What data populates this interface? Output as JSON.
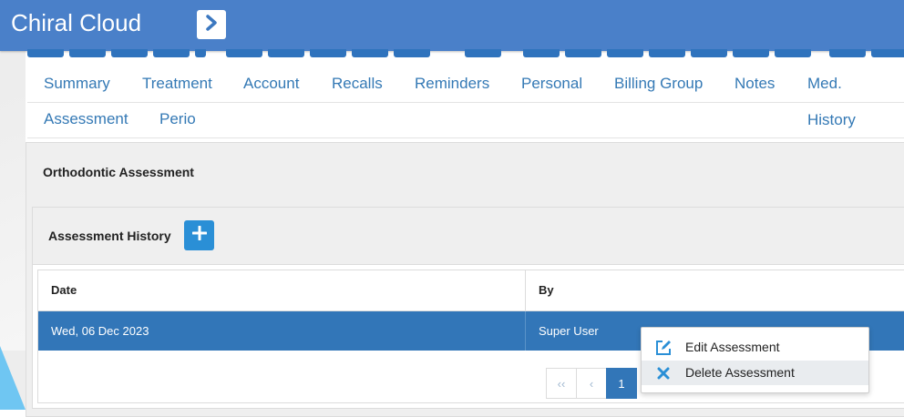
{
  "app": {
    "title": "Chiral Cloud",
    "brand_color": "#4a80c9"
  },
  "header": {
    "toggle_icon": "chevron-right-icon"
  },
  "tabs_row1": [
    "Summary",
    "Treatment",
    "Account",
    "Recalls",
    "Reminders",
    "Personal",
    "Billing Group",
    "Notes",
    "Med. History"
  ],
  "tabs_row2": [
    "Assessment",
    "Perio"
  ],
  "panel": {
    "title": "Orthodontic Assessment",
    "history": {
      "title": "Assessment History",
      "add_icon": "plus-icon",
      "columns": [
        "Date",
        "By"
      ],
      "rows": [
        {
          "date": "Wed, 06 Dec 2023",
          "by": "Super User"
        }
      ]
    }
  },
  "pagination": {
    "first": "‹‹",
    "prev": "‹",
    "current": "1"
  },
  "context_menu": {
    "items": [
      {
        "label": "Edit Assessment",
        "icon": "edit-icon"
      },
      {
        "label": "Delete Assessment",
        "icon": "close-icon"
      }
    ]
  },
  "colors": {
    "accent": "#2a8fd6",
    "selected_row": "#3276b8",
    "tab_text": "#3479b5"
  }
}
